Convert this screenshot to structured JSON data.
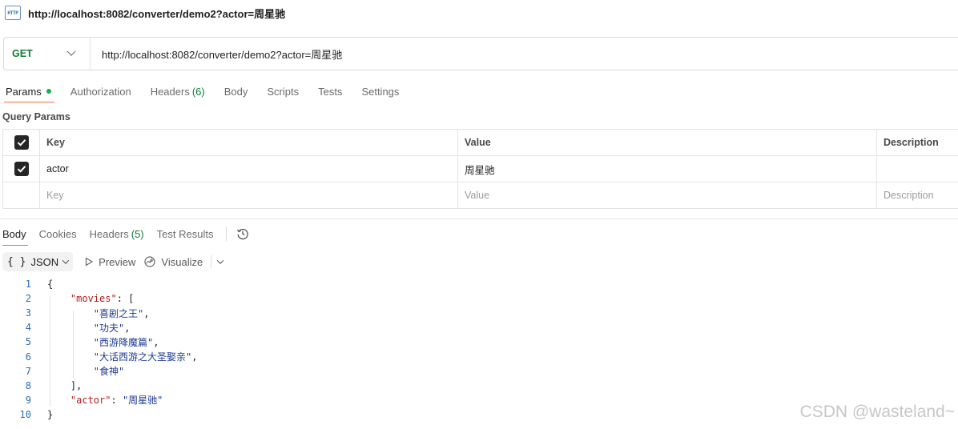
{
  "header": {
    "icon": "http-file-icon",
    "icon_text": "HTTP",
    "title": "http://localhost:8082/converter/demo2?actor=周星驰"
  },
  "request": {
    "method": "GET",
    "url": "http://localhost:8082/converter/demo2?actor=周星驰"
  },
  "request_tabs": [
    {
      "label": "Params"
    },
    {
      "label": "Authorization"
    },
    {
      "label": "Headers",
      "count": "(6)"
    },
    {
      "label": "Body"
    },
    {
      "label": "Scripts"
    },
    {
      "label": "Tests"
    },
    {
      "label": "Settings"
    }
  ],
  "query_params": {
    "title": "Query Params",
    "columns": {
      "key": "Key",
      "value": "Value",
      "description": "Description"
    },
    "rows": [
      {
        "key": "actor",
        "value": "周星驰",
        "description": ""
      }
    ],
    "placeholders": {
      "key": "Key",
      "value": "Value",
      "description": "Description"
    }
  },
  "response_tabs": [
    {
      "label": "Body"
    },
    {
      "label": "Cookies"
    },
    {
      "label": "Headers",
      "count": "(5)"
    },
    {
      "label": "Test Results"
    }
  ],
  "response_toolbar": {
    "format_icon": "{ }",
    "format": "JSON",
    "preview": "Preview",
    "visualize": "Visualize"
  },
  "code_lines": [
    {
      "n": "1",
      "parts": [
        [
          "p",
          "{"
        ]
      ]
    },
    {
      "n": "2",
      "parts": [
        [
          "p",
          "    "
        ],
        [
          "k",
          "\"movies\""
        ],
        [
          "p",
          ": ["
        ]
      ]
    },
    {
      "n": "3",
      "parts": [
        [
          "p",
          "        "
        ],
        [
          "s",
          "\"喜剧之王\""
        ],
        [
          "p",
          ","
        ]
      ]
    },
    {
      "n": "4",
      "parts": [
        [
          "p",
          "        "
        ],
        [
          "s",
          "\"功夫\""
        ],
        [
          "p",
          ","
        ]
      ]
    },
    {
      "n": "5",
      "parts": [
        [
          "p",
          "        "
        ],
        [
          "s",
          "\"西游降魔篇\""
        ],
        [
          "p",
          ","
        ]
      ]
    },
    {
      "n": "6",
      "parts": [
        [
          "p",
          "        "
        ],
        [
          "s",
          "\"大话西游之大圣娶亲\""
        ],
        [
          "p",
          ","
        ]
      ]
    },
    {
      "n": "7",
      "parts": [
        [
          "p",
          "        "
        ],
        [
          "s",
          "\"食神\""
        ]
      ]
    },
    {
      "n": "8",
      "parts": [
        [
          "p",
          "    ],"
        ]
      ]
    },
    {
      "n": "9",
      "parts": [
        [
          "p",
          "    "
        ],
        [
          "k",
          "\"actor\""
        ],
        [
          "p",
          ": "
        ],
        [
          "s",
          "\"周星驰\""
        ]
      ]
    },
    {
      "n": "10",
      "parts": [
        [
          "p",
          "}"
        ]
      ]
    }
  ],
  "watermark": "CSDN @wasteland~",
  "colors": {
    "accent": "#ff6c37",
    "method": "#0f7b38",
    "status_dot": "#0cb54a",
    "json_key": "#b31d1d",
    "json_string": "#1d3b93"
  }
}
